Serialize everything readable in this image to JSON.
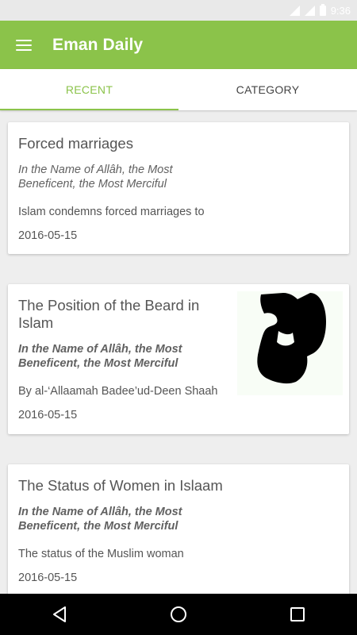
{
  "status_bar": {
    "time": "9:36"
  },
  "app_bar": {
    "title": "Eman Daily",
    "menu_icon": "hamburger-menu-icon"
  },
  "tabs": [
    {
      "label": "RECENT",
      "active": true
    },
    {
      "label": "CATEGORY",
      "active": false
    }
  ],
  "colors": {
    "accent": "#8bc34a",
    "background": "#eeeeee"
  },
  "articles": [
    {
      "title": "Forced marriages",
      "intro": "In the Name of Allâh, the Most Beneficent, the Most Merciful",
      "snippet": "Islam condemns forced marriages to",
      "date": "2016-05-15",
      "has_image": false
    },
    {
      "title": "The Position of the Beard in Islam",
      "intro": "In the Name of Allâh, the Most Beneficent, the Most Merciful",
      "snippet": "By al-‘Allaamah Badee’ud-Deen Shaah",
      "date": "2016-05-15",
      "has_image": true
    },
    {
      "title": "The Status of Women in Islaam",
      "intro": "In the Name of Allâh, the Most Beneficent, the Most Merciful",
      "snippet": "The status of the Muslim woman",
      "date": "2016-05-15",
      "has_image": false
    }
  ],
  "nav_bar": {
    "back_icon": "back-triangle-icon",
    "home_icon": "home-circle-icon",
    "recents_icon": "recents-square-icon"
  }
}
